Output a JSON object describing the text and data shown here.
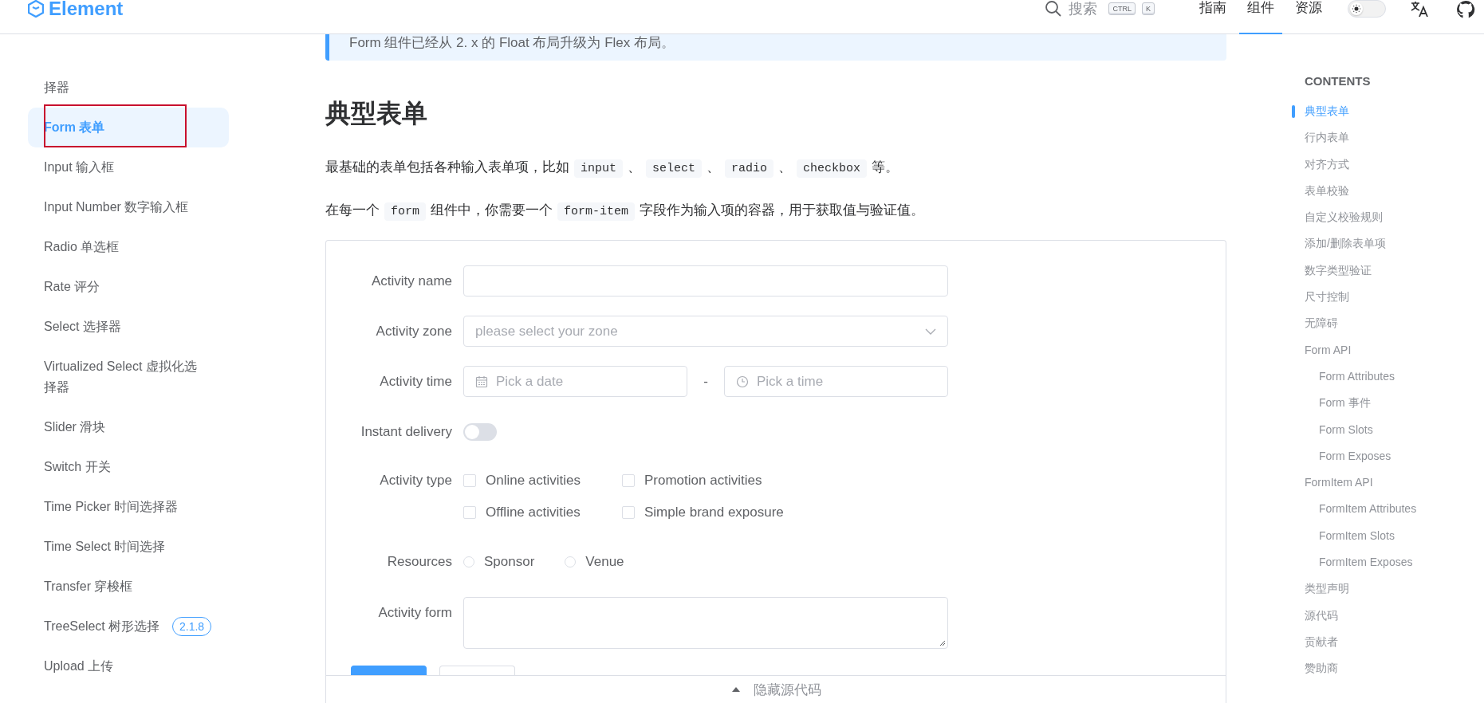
{
  "header": {
    "logo": "Element",
    "search": {
      "label": "搜索",
      "keys": [
        "CTRL",
        "K"
      ]
    },
    "nav": [
      {
        "label": "指南",
        "selected": false
      },
      {
        "label": "组件",
        "selected": true
      },
      {
        "label": "资源",
        "selected": false
      }
    ],
    "dark_mode": false
  },
  "sidebar": {
    "items": [
      {
        "label": "择器",
        "selected": false
      },
      {
        "label": "Form 表单",
        "selected": true
      },
      {
        "label": "Input 输入框",
        "selected": false
      },
      {
        "label": "Input Number 数字输入框",
        "selected": false
      },
      {
        "label": "Radio 单选框",
        "selected": false
      },
      {
        "label": "Rate 评分",
        "selected": false
      },
      {
        "label": "Select 选择器",
        "selected": false
      },
      {
        "label": "Virtualized Select 虚拟化选择器",
        "selected": false
      },
      {
        "label": "Slider 滑块",
        "selected": false
      },
      {
        "label": "Switch 开关",
        "selected": false
      },
      {
        "label": "Time Picker 时间选择器",
        "selected": false
      },
      {
        "label": "Time Select 时间选择",
        "selected": false
      },
      {
        "label": "Transfer 穿梭框",
        "selected": false
      },
      {
        "label": "TreeSelect 树形选择",
        "selected": false,
        "badge": "2.1.8"
      },
      {
        "label": "Upload 上传",
        "selected": false
      }
    ]
  },
  "notice": "Form 组件已经从 2. x 的 Float 布局升级为 Flex 布局。",
  "heading": "典型表单",
  "paragraphs": [
    [
      {
        "kind": "text",
        "text": "最基础的表单包括各种输入表单项，比如"
      },
      {
        "kind": "code",
        "text": "input"
      },
      {
        "kind": "text",
        "text": "、"
      },
      {
        "kind": "code",
        "text": "select"
      },
      {
        "kind": "text",
        "text": "、"
      },
      {
        "kind": "code",
        "text": "radio"
      },
      {
        "kind": "text",
        "text": "、"
      },
      {
        "kind": "code",
        "text": "checkbox"
      },
      {
        "kind": "text",
        "text": "等。"
      }
    ],
    [
      {
        "kind": "text",
        "text": "在每一个"
      },
      {
        "kind": "code",
        "text": "form"
      },
      {
        "kind": "text",
        "text": "组件中，你需要一个"
      },
      {
        "kind": "code",
        "text": "form-item"
      },
      {
        "kind": "text",
        "text": "字段作为输入项的容器，用于获取值与验证值。"
      }
    ]
  ],
  "form": {
    "fields": [
      {
        "kind": "input",
        "label": "Activity name"
      },
      {
        "kind": "select",
        "label": "Activity zone",
        "placeholder": "please select your zone"
      },
      {
        "kind": "datetime",
        "label": "Activity time",
        "date_placeholder": "Pick a date",
        "separator": "-",
        "time_placeholder": "Pick a time"
      },
      {
        "kind": "switch",
        "label": "Instant delivery",
        "on": false
      },
      {
        "kind": "checkboxes",
        "label": "Activity type",
        "options": [
          {
            "label": "Online activities",
            "checked": false
          },
          {
            "label": "Promotion activities",
            "checked": false
          },
          {
            "label": "Offline activities",
            "checked": false
          },
          {
            "label": "Simple brand exposure",
            "checked": false
          }
        ]
      },
      {
        "kind": "radios",
        "label": "Resources",
        "options": [
          {
            "label": "Sponsor",
            "selected": false
          },
          {
            "label": "Venue",
            "selected": false
          }
        ]
      },
      {
        "kind": "textarea",
        "label": "Activity form"
      }
    ]
  },
  "source_toggle": "隐藏源代码",
  "toc": {
    "title": "CONTENTS",
    "items": [
      {
        "label": "典型表单",
        "selected": true
      },
      {
        "label": "行内表单",
        "selected": false
      },
      {
        "label": "对齐方式",
        "selected": false
      },
      {
        "label": "表单校验",
        "selected": false
      },
      {
        "label": "自定义校验规则",
        "selected": false
      },
      {
        "label": "添加/删除表单项",
        "selected": false
      },
      {
        "label": "数字类型验证",
        "selected": false
      },
      {
        "label": "尺寸控制",
        "selected": false
      },
      {
        "label": "无障碍",
        "selected": false
      },
      {
        "label": "Form API",
        "selected": false,
        "children": [
          {
            "label": "Form Attributes",
            "selected": false
          },
          {
            "label": "Form 事件",
            "selected": false
          },
          {
            "label": "Form Slots",
            "selected": false
          },
          {
            "label": "Form Exposes",
            "selected": false
          }
        ]
      },
      {
        "label": "FormItem API",
        "selected": false,
        "children": [
          {
            "label": "FormItem Attributes",
            "selected": false
          },
          {
            "label": "FormItem Slots",
            "selected": false
          },
          {
            "label": "FormItem Exposes",
            "selected": false
          }
        ]
      },
      {
        "label": "类型声明",
        "selected": false
      },
      {
        "label": "源代码",
        "selected": false
      },
      {
        "label": "贡献者",
        "selected": false
      },
      {
        "label": "赞助商",
        "selected": false
      }
    ]
  }
}
